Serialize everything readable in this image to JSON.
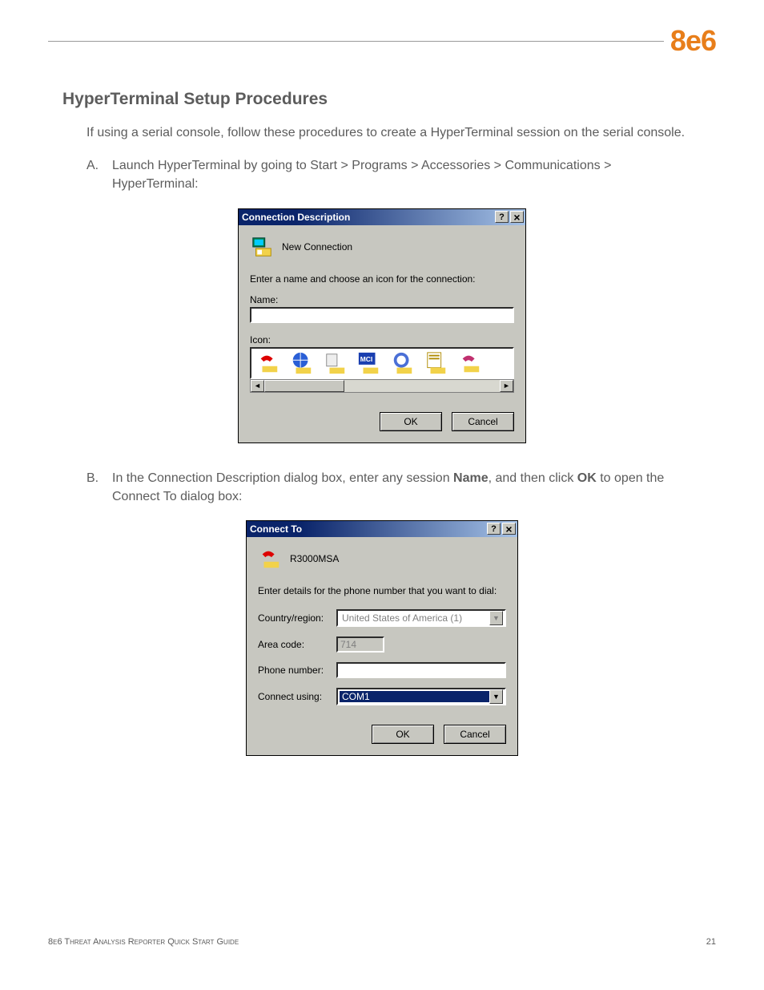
{
  "logo": "8e6",
  "heading": "HyperTerminal Setup Procedures",
  "intro": "If using a serial console, follow these procedures to create a HyperTerminal session on the serial console.",
  "stepA": {
    "marker": "A.",
    "text": "Launch HyperTerminal by going to Start > Programs > Accessories > Communications > HyperTerminal:"
  },
  "dialog1": {
    "title": "Connection Description",
    "new_conn": "New Connection",
    "prompt": "Enter a name and choose an icon for the connection:",
    "name_label": "Name:",
    "name_value": "",
    "icon_label": "Icon:",
    "ok": "OK",
    "cancel": "Cancel"
  },
  "stepB": {
    "marker": "B.",
    "pre": "In the Connection Description dialog box, enter any session ",
    "bold1": "Name",
    "mid": ", and then click ",
    "bold2": "OK",
    "post": " to open the Connect To dialog box:"
  },
  "dialog2": {
    "title": "Connect To",
    "session": "R3000MSA",
    "prompt": "Enter details for the phone number that you want to dial:",
    "country_label": "Country/region:",
    "country_value": "United States of America (1)",
    "area_label": "Area code:",
    "area_value": "714",
    "phone_label": "Phone number:",
    "phone_value": "",
    "connect_label": "Connect using:",
    "connect_value": "COM1",
    "ok": "OK",
    "cancel": "Cancel"
  },
  "footer_left": "8e6 Threat Analysis Reporter Quick Start Guide",
  "footer_right": "21"
}
